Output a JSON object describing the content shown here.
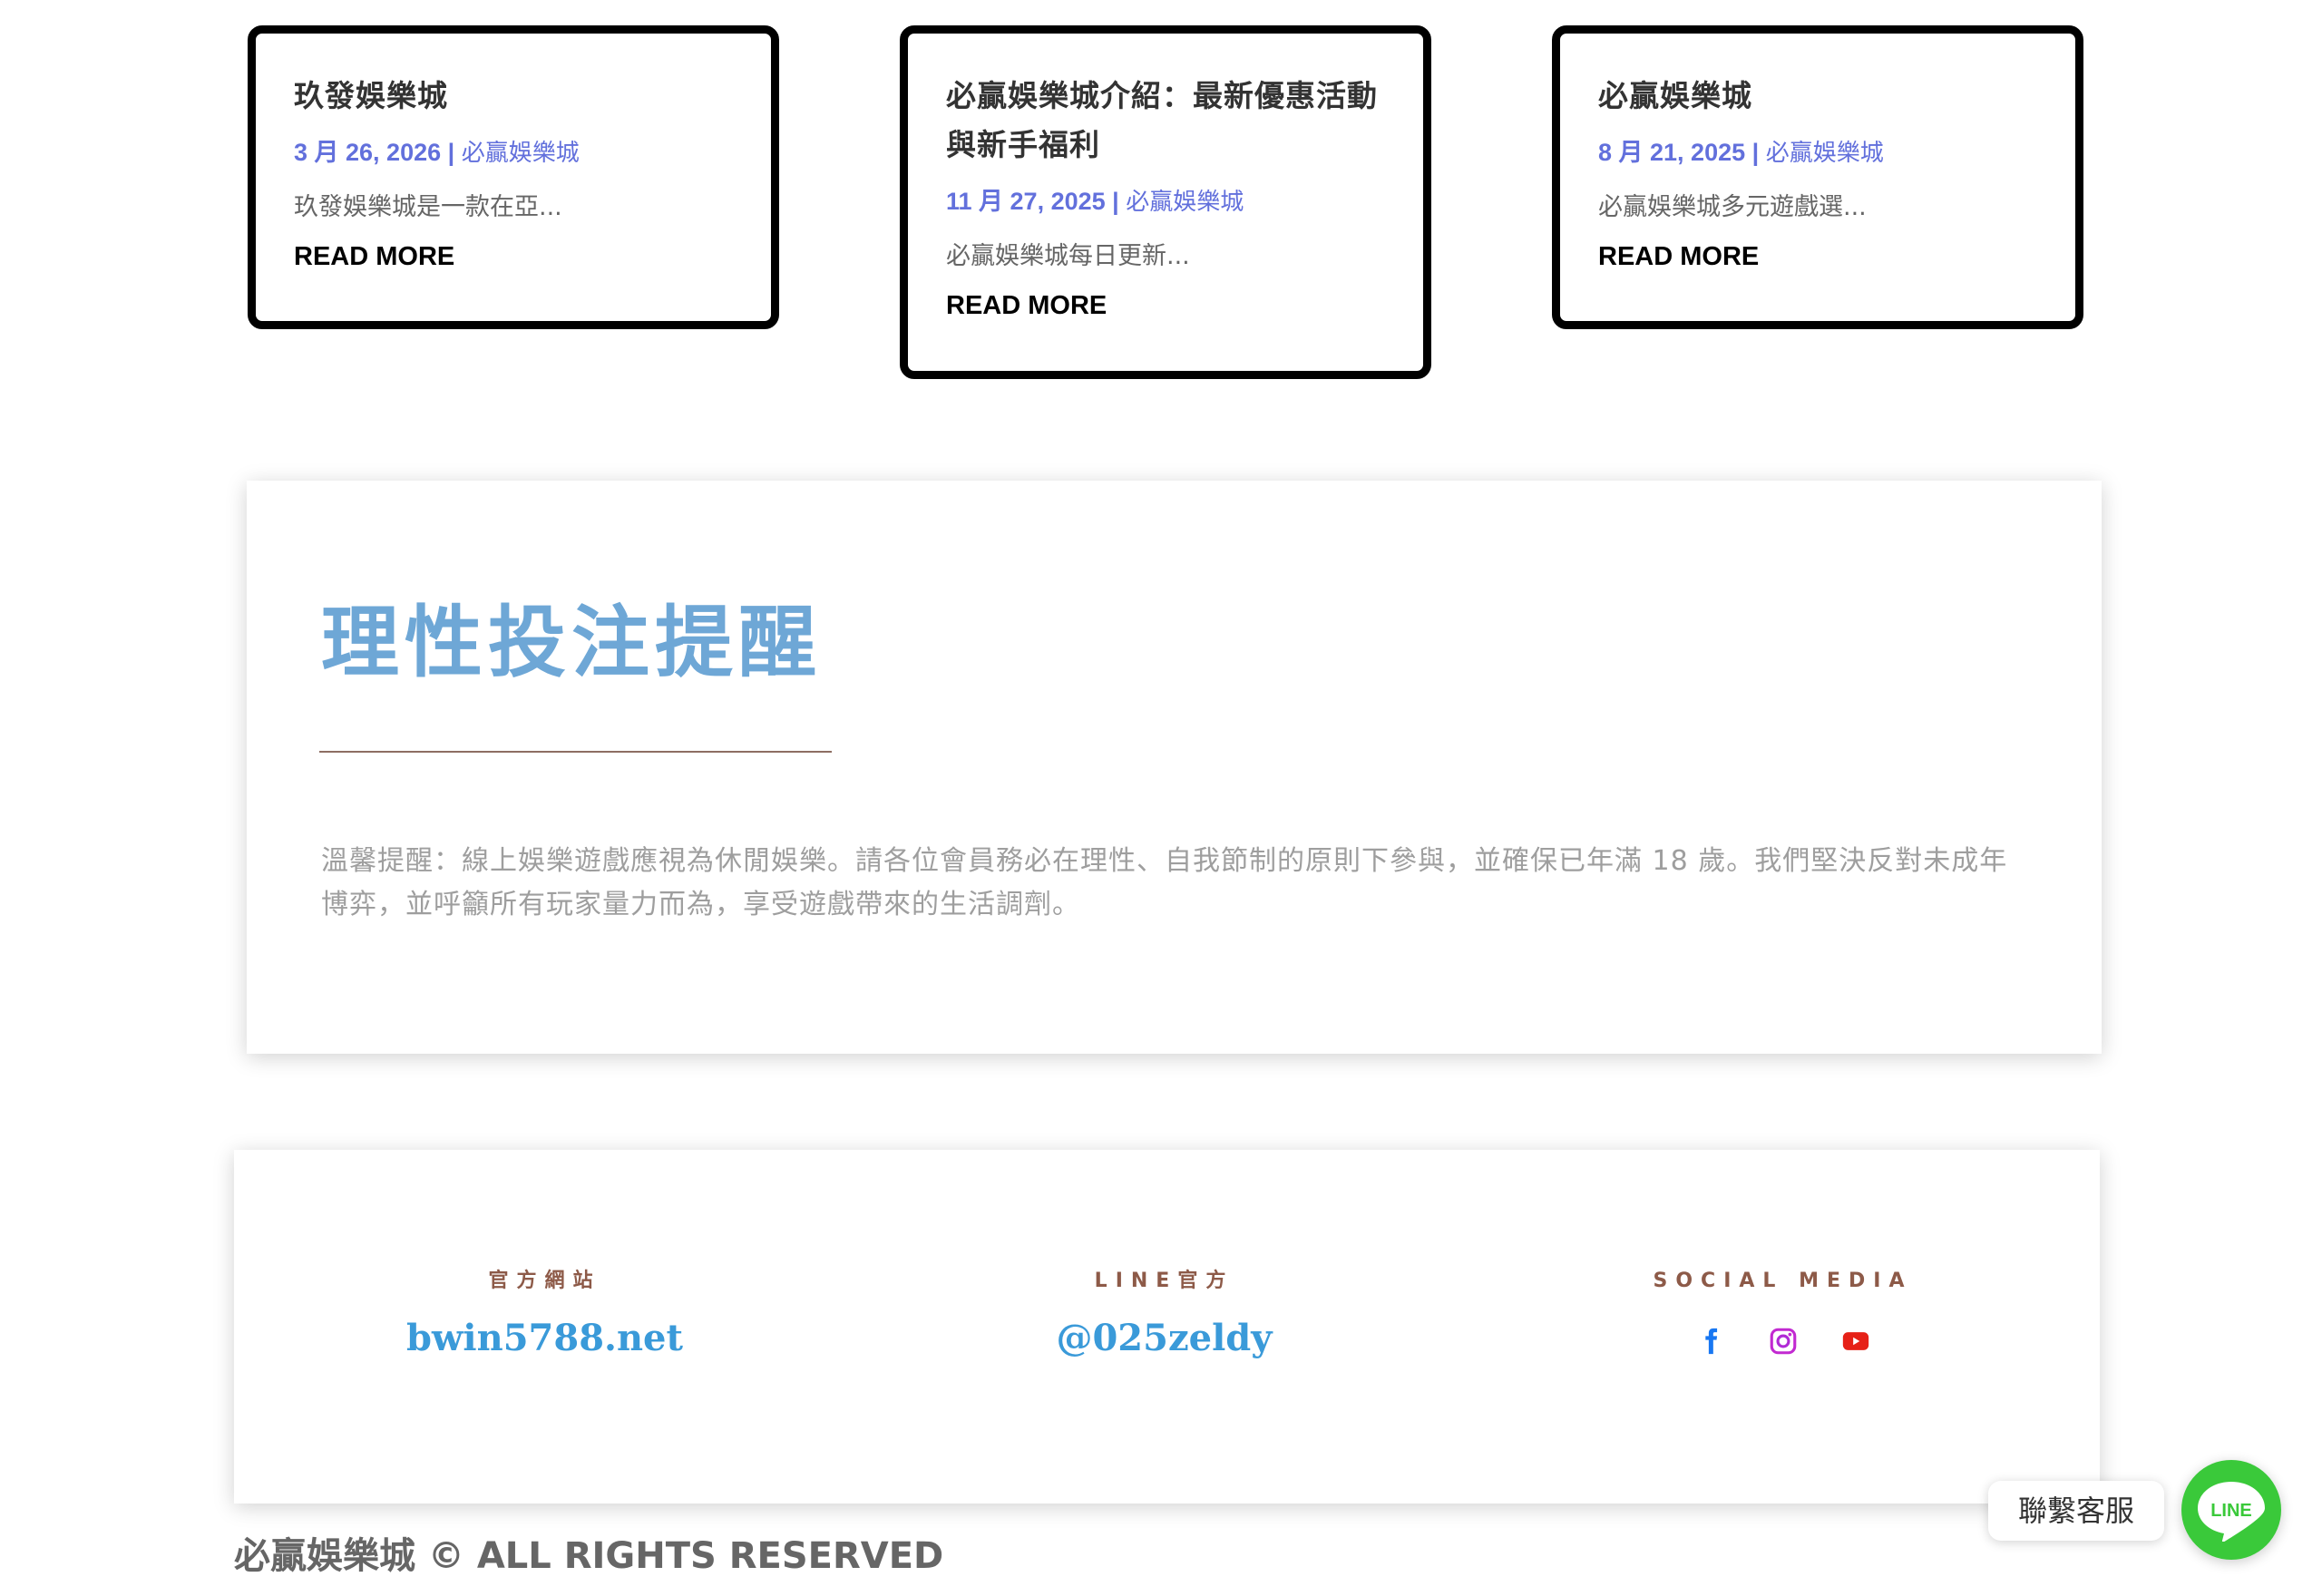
{
  "posts": [
    {
      "title": "玖發娛樂城",
      "date": "3 月 26, 2026",
      "separator": " | ",
      "category": "必贏娛樂城",
      "excerpt": "玖發娛樂城是一款在亞...",
      "read_more": "READ MORE"
    },
    {
      "title": "必贏娛樂城介紹：最新優惠活動與新手福利",
      "date": "11 月 27, 2025",
      "separator": " | ",
      "category": "必贏娛樂城",
      "excerpt": "必贏娛樂城每日更新...",
      "read_more": "READ MORE"
    },
    {
      "title": "必贏娛樂城",
      "date": "8 月 21, 2025",
      "separator": " | ",
      "category": "必贏娛樂城",
      "excerpt": "必贏娛樂城多元遊戲選...",
      "read_more": "READ MORE"
    }
  ],
  "notice": {
    "title": "理性投注提醒",
    "text": "溫馨提醒：線上娛樂遊戲應視為休閒娛樂。請各位會員務必在理性、自我節制的原則下參與，並確保已年滿 18 歲。我們堅決反對未成年博弈，並呼籲所有玩家量力而為，享受遊戲帶來的生活調劑。"
  },
  "contact": {
    "website_label": "官方網站",
    "website_value": "bwin5788.net",
    "line_label": "LINE官方",
    "line_value": "@025zeldy",
    "social_label": "SOCIAL MEDIA",
    "social_icons": [
      "facebook-icon",
      "instagram-icon",
      "youtube-icon"
    ]
  },
  "copyright": "必贏娛樂城 © ALL RIGHTS RESERVED",
  "line_widget": {
    "label": "聯繫客服",
    "icon_text": "LINE"
  },
  "colors": {
    "accent_meta": "#6270dc",
    "notice_title": "#6ea7d6",
    "contact_value": "#3a9ad9",
    "contact_label": "#8d5a48",
    "line_green": "#3ac93a",
    "facebook": "#1877f2",
    "youtube": "#e62117"
  }
}
